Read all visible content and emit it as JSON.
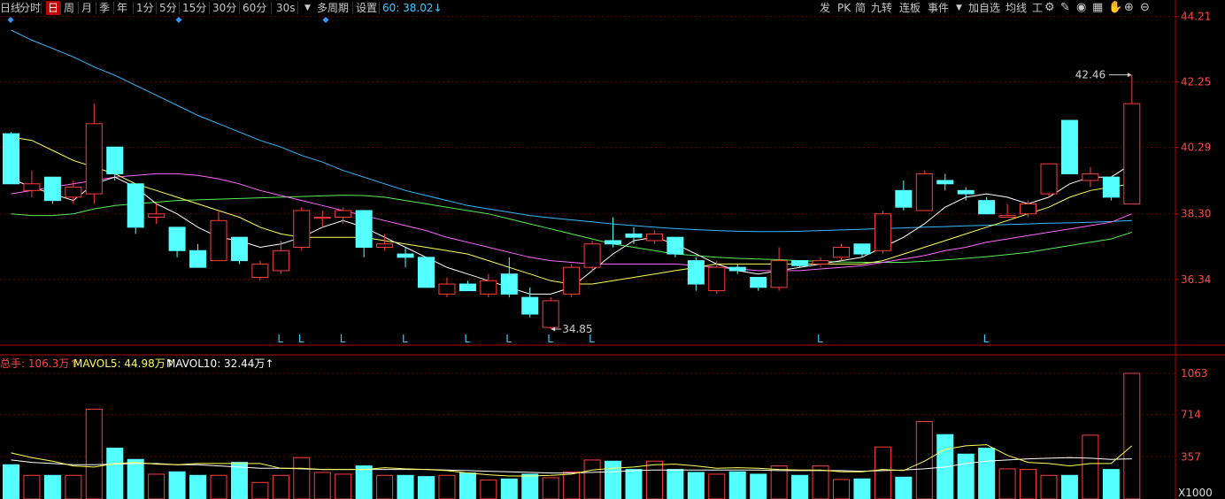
{
  "toolbar": {
    "left": [
      {
        "label": "日线",
        "active": false
      },
      {
        "label": "分时",
        "active": false
      },
      {
        "label": "日",
        "active": true
      },
      {
        "label": "周",
        "active": false
      },
      {
        "label": "月",
        "active": false
      },
      {
        "label": "季",
        "active": false
      },
      {
        "label": "年",
        "active": false
      },
      {
        "label": "1分",
        "active": false
      },
      {
        "label": "5分",
        "active": false
      },
      {
        "label": "15分",
        "active": false
      },
      {
        "label": "30分",
        "active": false
      },
      {
        "label": "60分",
        "active": false
      },
      {
        "label": "30s",
        "active": false
      },
      {
        "label": "多周期",
        "active": false
      },
      {
        "label": "设置",
        "active": false
      }
    ],
    "dropdown_icon": "caret-down-icon",
    "period_info": "60: 38.02↓",
    "right": [
      {
        "label": "发"
      },
      {
        "label": "PK"
      },
      {
        "label": "简"
      },
      {
        "label": "九转"
      },
      {
        "label": "连板"
      },
      {
        "label": "事件"
      },
      {
        "label": "加自选"
      },
      {
        "label": "均线"
      },
      {
        "label": "工"
      }
    ],
    "right_icons": [
      "settings-icon",
      "brush-icon",
      "eye-icon",
      "calculator-icon",
      "hand-icon",
      "zoom-in-icon",
      "zoom-out-icon"
    ]
  },
  "chart_data": [
    {
      "type": "candlestick",
      "panel": "price",
      "ylim": [
        34.4,
        44.21
      ],
      "y_ticks": [
        "44.21",
        "42.25",
        "40.29",
        "38.30",
        "36.34"
      ],
      "high_label": "42.46",
      "low_label": "34.85",
      "marker": "L",
      "colors": {
        "up": "#ff3b3b",
        "down": "#54ffff",
        "ma5": "#ffffff",
        "ma10": "#ffff55",
        "ma20": "#ff66ff",
        "ma30": "#55ee55",
        "ma60": "#33bbff"
      },
      "candles": [
        {
          "o": 40.7,
          "h": 40.75,
          "l": 39.2,
          "c": 39.2,
          "signal": false
        },
        {
          "o": 39.0,
          "h": 39.6,
          "l": 38.8,
          "c": 39.2,
          "signal": false
        },
        {
          "o": 39.4,
          "h": 39.4,
          "l": 38.6,
          "c": 38.7,
          "signal": false
        },
        {
          "o": 38.8,
          "h": 39.3,
          "l": 38.6,
          "c": 39.1,
          "signal": false
        },
        {
          "o": 38.9,
          "h": 41.6,
          "l": 38.6,
          "c": 41.0,
          "signal": false
        },
        {
          "o": 40.3,
          "h": 40.3,
          "l": 39.3,
          "c": 39.5,
          "signal": false
        },
        {
          "o": 39.2,
          "h": 39.2,
          "l": 37.7,
          "c": 37.9,
          "signal": false
        },
        {
          "o": 38.2,
          "h": 38.6,
          "l": 38.0,
          "c": 38.3,
          "signal": false
        },
        {
          "o": 37.9,
          "h": 37.9,
          "l": 37.0,
          "c": 37.2,
          "signal": false
        },
        {
          "o": 37.2,
          "h": 37.4,
          "l": 36.7,
          "c": 36.7,
          "signal": false
        },
        {
          "o": 36.9,
          "h": 38.4,
          "l": 36.9,
          "c": 38.1,
          "signal": false
        },
        {
          "o": 37.6,
          "h": 37.6,
          "l": 36.8,
          "c": 36.9,
          "signal": false
        },
        {
          "o": 36.4,
          "h": 36.9,
          "l": 36.3,
          "c": 36.8,
          "signal": false
        },
        {
          "o": 36.6,
          "h": 37.5,
          "l": 36.5,
          "c": 37.2,
          "signal": true
        },
        {
          "o": 37.3,
          "h": 38.5,
          "l": 37.2,
          "c": 38.4,
          "signal": true
        },
        {
          "o": 38.2,
          "h": 38.4,
          "l": 37.9,
          "c": 38.2,
          "signal": false
        },
        {
          "o": 38.2,
          "h": 38.5,
          "l": 38.0,
          "c": 38.4,
          "signal": true
        },
        {
          "o": 38.4,
          "h": 38.4,
          "l": 37.0,
          "c": 37.3,
          "signal": false
        },
        {
          "o": 37.3,
          "h": 37.7,
          "l": 37.2,
          "c": 37.4,
          "signal": false
        },
        {
          "o": 37.1,
          "h": 37.3,
          "l": 36.7,
          "c": 37.0,
          "signal": true
        },
        {
          "o": 37.0,
          "h": 37.0,
          "l": 36.1,
          "c": 36.1,
          "signal": false
        },
        {
          "o": 35.9,
          "h": 36.4,
          "l": 35.8,
          "c": 36.2,
          "signal": false
        },
        {
          "o": 36.2,
          "h": 36.3,
          "l": 36.0,
          "c": 36.0,
          "signal": true
        },
        {
          "o": 35.9,
          "h": 36.5,
          "l": 35.8,
          "c": 36.3,
          "signal": false
        },
        {
          "o": 36.5,
          "h": 37.0,
          "l": 35.8,
          "c": 35.9,
          "signal": true
        },
        {
          "o": 35.8,
          "h": 36.1,
          "l": 35.2,
          "c": 35.3,
          "signal": false
        },
        {
          "o": 34.9,
          "h": 35.8,
          "l": 34.85,
          "c": 35.7,
          "signal": true
        },
        {
          "o": 35.9,
          "h": 36.8,
          "l": 35.8,
          "c": 36.7,
          "signal": false
        },
        {
          "o": 36.7,
          "h": 37.5,
          "l": 36.6,
          "c": 37.4,
          "signal": true
        },
        {
          "o": 37.5,
          "h": 38.2,
          "l": 37.3,
          "c": 37.4,
          "signal": false
        },
        {
          "o": 37.7,
          "h": 37.9,
          "l": 37.4,
          "c": 37.6,
          "signal": false
        },
        {
          "o": 37.5,
          "h": 37.8,
          "l": 37.4,
          "c": 37.7,
          "signal": false
        },
        {
          "o": 37.6,
          "h": 37.6,
          "l": 37.0,
          "c": 37.1,
          "signal": false
        },
        {
          "o": 36.9,
          "h": 37.0,
          "l": 36.0,
          "c": 36.2,
          "signal": false
        },
        {
          "o": 36.0,
          "h": 36.9,
          "l": 35.9,
          "c": 36.7,
          "signal": false
        },
        {
          "o": 36.7,
          "h": 36.8,
          "l": 36.5,
          "c": 36.6,
          "signal": false
        },
        {
          "o": 36.4,
          "h": 36.4,
          "l": 36.0,
          "c": 36.1,
          "signal": false
        },
        {
          "o": 36.1,
          "h": 37.3,
          "l": 36.0,
          "c": 36.9,
          "signal": false
        },
        {
          "o": 36.9,
          "h": 36.9,
          "l": 36.7,
          "c": 36.75,
          "signal": false
        },
        {
          "o": 36.8,
          "h": 37.0,
          "l": 36.7,
          "c": 36.9,
          "signal": true
        },
        {
          "o": 37.0,
          "h": 37.4,
          "l": 36.9,
          "c": 37.3,
          "signal": false
        },
        {
          "o": 37.4,
          "h": 37.4,
          "l": 37.0,
          "c": 37.1,
          "signal": false
        },
        {
          "o": 37.2,
          "h": 38.4,
          "l": 37.1,
          "c": 38.3,
          "signal": false
        },
        {
          "o": 39.0,
          "h": 39.3,
          "l": 38.4,
          "c": 38.5,
          "signal": false
        },
        {
          "o": 38.4,
          "h": 39.6,
          "l": 38.4,
          "c": 39.5,
          "signal": false
        },
        {
          "o": 39.3,
          "h": 39.5,
          "l": 39.0,
          "c": 39.2,
          "signal": false
        },
        {
          "o": 39.0,
          "h": 39.1,
          "l": 38.7,
          "c": 38.9,
          "signal": false
        },
        {
          "o": 38.7,
          "h": 38.8,
          "l": 38.3,
          "c": 38.3,
          "signal": true
        },
        {
          "o": 38.2,
          "h": 38.6,
          "l": 38.2,
          "c": 38.25,
          "signal": false
        },
        {
          "o": 38.3,
          "h": 38.7,
          "l": 38.2,
          "c": 38.6,
          "signal": false
        },
        {
          "o": 38.9,
          "h": 39.8,
          "l": 38.8,
          "c": 39.8,
          "signal": false
        },
        {
          "o": 41.1,
          "h": 41.1,
          "l": 39.5,
          "c": 39.5,
          "signal": false
        },
        {
          "o": 39.3,
          "h": 39.7,
          "l": 39.1,
          "c": 39.5,
          "signal": false
        },
        {
          "o": 39.4,
          "h": 39.4,
          "l": 38.7,
          "c": 38.8,
          "signal": false
        },
        {
          "o": 38.6,
          "h": 42.46,
          "l": 38.6,
          "c": 41.6,
          "signal": false
        }
      ],
      "ma5": [
        39.35,
        39.1,
        38.9,
        38.7,
        39.2,
        39.4,
        39.1,
        38.6,
        38.3,
        37.9,
        37.6,
        37.5,
        37.3,
        37.4,
        37.6,
        37.9,
        38.1,
        37.9,
        37.6,
        37.3,
        37.0,
        36.7,
        36.5,
        36.3,
        36.1,
        35.9,
        35.9,
        36.1,
        36.6,
        37.1,
        37.5,
        37.6,
        37.4,
        37.1,
        36.8,
        36.6,
        36.5,
        36.6,
        36.7,
        36.8,
        36.9,
        37.0,
        37.3,
        37.6,
        38.0,
        38.5,
        38.8,
        38.9,
        38.8,
        38.6,
        38.8,
        39.2,
        39.4,
        39.4,
        39.8
      ],
      "ma10": [
        40.6,
        40.5,
        40.2,
        39.9,
        39.7,
        39.5,
        39.2,
        39.0,
        38.8,
        38.6,
        38.4,
        38.2,
        37.9,
        37.7,
        37.6,
        37.6,
        37.6,
        37.6,
        37.5,
        37.4,
        37.3,
        37.2,
        37.1,
        36.9,
        36.7,
        36.5,
        36.3,
        36.2,
        36.2,
        36.3,
        36.4,
        36.5,
        36.6,
        36.7,
        36.8,
        36.8,
        36.8,
        36.8,
        36.8,
        36.8,
        36.8,
        36.8,
        36.9,
        37.1,
        37.3,
        37.5,
        37.7,
        37.9,
        38.1,
        38.3,
        38.5,
        38.8,
        39.0,
        39.1,
        39.2
      ],
      "ma20": [
        38.9,
        39.0,
        39.1,
        39.2,
        39.3,
        39.4,
        39.45,
        39.5,
        39.5,
        39.45,
        39.35,
        39.2,
        39.0,
        38.85,
        38.7,
        38.55,
        38.4,
        38.25,
        38.1,
        37.95,
        37.8,
        37.6,
        37.45,
        37.3,
        37.15,
        37.0,
        36.9,
        36.85,
        36.8,
        36.8,
        36.8,
        36.8,
        36.8,
        36.75,
        36.7,
        36.65,
        36.6,
        36.6,
        36.6,
        36.65,
        36.7,
        36.75,
        36.85,
        36.95,
        37.05,
        37.2,
        37.3,
        37.45,
        37.55,
        37.65,
        37.75,
        37.85,
        37.95,
        38.05,
        38.3
      ],
      "ma30": [
        38.3,
        38.25,
        38.25,
        38.3,
        38.45,
        38.55,
        38.6,
        38.65,
        38.7,
        38.72,
        38.74,
        38.76,
        38.78,
        38.8,
        38.82,
        38.84,
        38.86,
        38.85,
        38.8,
        38.7,
        38.6,
        38.5,
        38.4,
        38.3,
        38.15,
        38.0,
        37.85,
        37.7,
        37.55,
        37.4,
        37.3,
        37.2,
        37.1,
        37.05,
        37.0,
        36.97,
        36.95,
        36.93,
        36.9,
        36.88,
        36.86,
        36.85,
        36.85,
        36.85,
        36.88,
        36.92,
        36.97,
        37.02,
        37.08,
        37.15,
        37.25,
        37.35,
        37.45,
        37.55,
        37.75
      ],
      "ma60": [
        43.8,
        43.5,
        43.25,
        43.0,
        42.7,
        42.45,
        42.15,
        41.85,
        41.55,
        41.25,
        41.0,
        40.75,
        40.5,
        40.3,
        40.05,
        39.85,
        39.6,
        39.4,
        39.2,
        39.0,
        38.85,
        38.7,
        38.55,
        38.45,
        38.35,
        38.25,
        38.18,
        38.12,
        38.06,
        38.0,
        37.95,
        37.9,
        37.86,
        37.83,
        37.8,
        37.78,
        37.77,
        37.77,
        37.78,
        37.8,
        37.82,
        37.84,
        37.86,
        37.88,
        37.9,
        37.92,
        37.94,
        37.96,
        37.98,
        38.0,
        38.02,
        38.03,
        38.05,
        38.07,
        38.1
      ]
    },
    {
      "type": "bar",
      "panel": "volume",
      "title": "总手: 106.3万↑",
      "legend": [
        "MAVOL5: 44.98万↑",
        "MAVOL10: 32.44万↑"
      ],
      "ylim": [
        0,
        1063
      ],
      "y_ticks": [
        "1063",
        "714",
        "357"
      ],
      "y_unit": "X1000",
      "values": [
        290,
        200,
        200,
        200,
        760,
        430,
        335,
        210,
        230,
        200,
        200,
        310,
        140,
        200,
        350,
        225,
        210,
        280,
        200,
        200,
        190,
        200,
        220,
        160,
        170,
        210,
        180,
        230,
        330,
        320,
        250,
        320,
        250,
        225,
        210,
        230,
        210,
        280,
        200,
        280,
        165,
        170,
        440,
        185,
        655,
        545,
        380,
        430,
        255,
        250,
        200,
        200,
        540,
        250,
        1063
      ],
      "mavol5": [
        390,
        350,
        320,
        280,
        270,
        300,
        310,
        295,
        290,
        300,
        300,
        300,
        300,
        260,
        260,
        250,
        250,
        250,
        265,
        255,
        250,
        240,
        220,
        205,
        195,
        195,
        200,
        210,
        245,
        260,
        270,
        290,
        295,
        280,
        260,
        265,
        260,
        250,
        245,
        245,
        230,
        230,
        250,
        240,
        320,
        420,
        450,
        460,
        370,
        310,
        300,
        280,
        300,
        300,
        450
      ],
      "mavol10": [
        330,
        310,
        300,
        290,
        290,
        295,
        300,
        300,
        290,
        290,
        280,
        270,
        260,
        260,
        255,
        250,
        250,
        250,
        250,
        250,
        250,
        245,
        240,
        235,
        230,
        225,
        220,
        220,
        225,
        230,
        240,
        245,
        245,
        245,
        245,
        245,
        245,
        240,
        240,
        240,
        240,
        235,
        240,
        245,
        255,
        270,
        300,
        320,
        330,
        340,
        345,
        350,
        345,
        335,
        340
      ]
    }
  ]
}
